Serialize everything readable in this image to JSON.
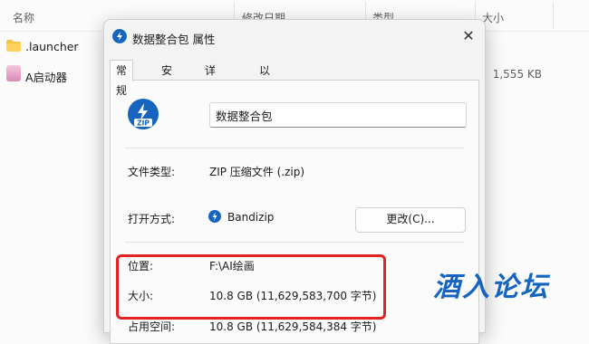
{
  "explorer": {
    "columns": {
      "name": "名称",
      "modified": "修改日期",
      "type": "类型",
      "size": "大小"
    },
    "files": [
      {
        "name": ".launcher",
        "size": "",
        "icon": "folder-icon"
      },
      {
        "name": "A启动器",
        "size": "1,555 KB",
        "icon": "app-icon"
      }
    ]
  },
  "dialog": {
    "title": "数据整合包 属性",
    "close_label": "✕",
    "tabs": [
      {
        "label": "常规",
        "active": true
      },
      {
        "label": "安全",
        "active": false
      },
      {
        "label": "详细信息",
        "active": false
      },
      {
        "label": "以前的版本",
        "active": false
      }
    ],
    "file_name": "数据整合包",
    "file_type": {
      "label": "文件类型:",
      "value": "ZIP 压缩文件 (.zip)"
    },
    "open_with": {
      "label": "打开方式:",
      "value": "Bandizip",
      "button": "更改(C)..."
    },
    "location": {
      "label": "位置:",
      "value": "F:\\AI绘画"
    },
    "size": {
      "label": "大小:",
      "value": "10.8 GB (11,629,583,700 字节)"
    },
    "size_on_disk": {
      "label": "占用空间:",
      "value": "10.8 GB (11,629,584,384 字节)"
    }
  },
  "watermark": {
    "text": "酒入论坛",
    "color": "#1565c0"
  },
  "highlight": {
    "color": "#e52222"
  },
  "colors": {
    "accent": "#1565c0",
    "folder": "#f4c542"
  }
}
